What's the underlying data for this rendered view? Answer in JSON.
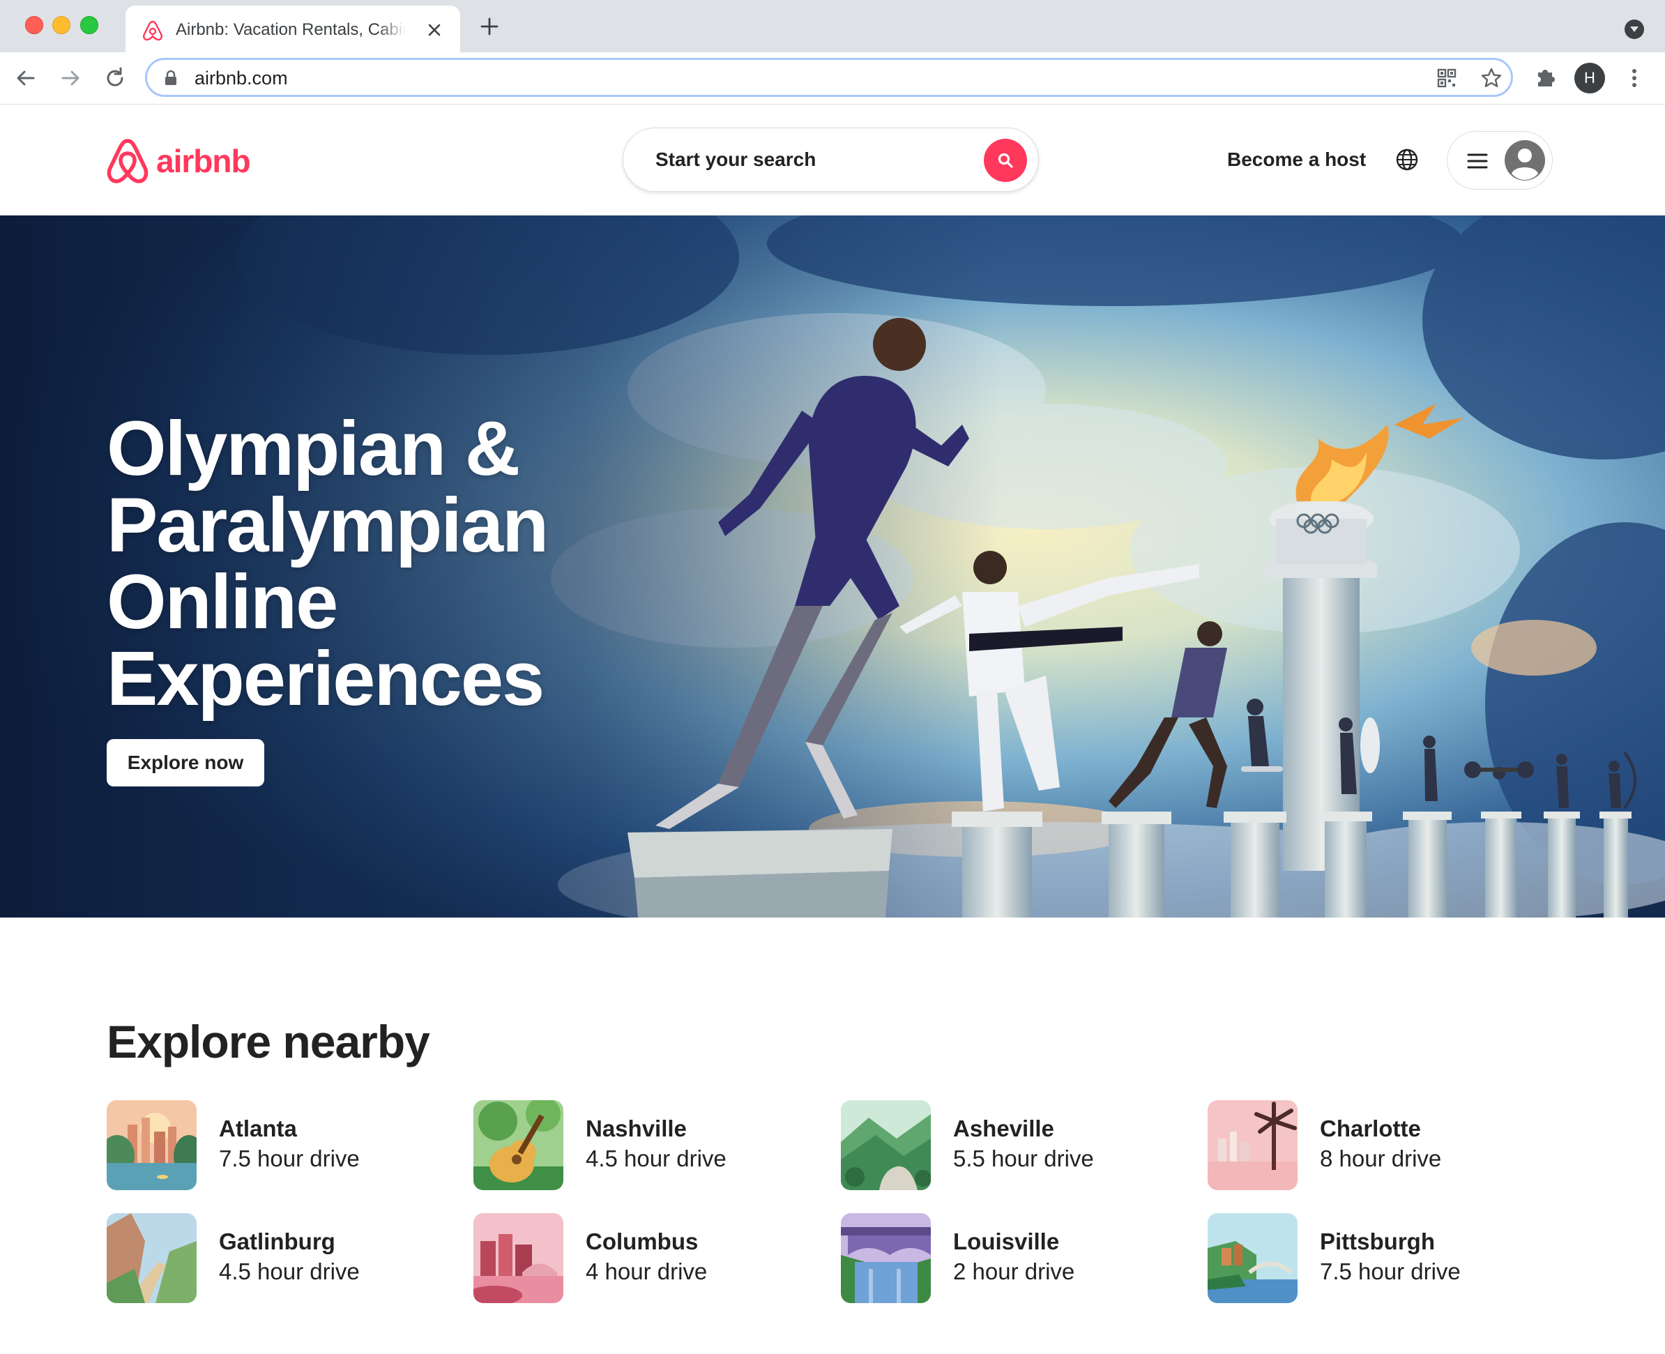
{
  "browser": {
    "tab_title": "Airbnb: Vacation Rentals, Cabins",
    "url": "airbnb.com",
    "profile_initial": "H"
  },
  "header": {
    "brand": "airbnb",
    "search_label": "Start your search",
    "host_link": "Become a host",
    "brand_color": "#ff385c"
  },
  "hero": {
    "title_lines": [
      "Olympian &",
      "Paralympian",
      "Online",
      "Experiences"
    ],
    "button_label": "Explore now"
  },
  "explore": {
    "title": "Explore nearby",
    "destinations": [
      {
        "name": "Atlanta",
        "drive": "7.5 hour drive"
      },
      {
        "name": "Nashville",
        "drive": "4.5 hour drive"
      },
      {
        "name": "Asheville",
        "drive": "5.5 hour drive"
      },
      {
        "name": "Charlotte",
        "drive": "8 hour drive"
      },
      {
        "name": "Gatlinburg",
        "drive": "4.5 hour drive"
      },
      {
        "name": "Columbus",
        "drive": "4 hour drive"
      },
      {
        "name": "Louisville",
        "drive": "2 hour drive"
      },
      {
        "name": "Pittsburgh",
        "drive": "7.5 hour drive"
      }
    ]
  }
}
